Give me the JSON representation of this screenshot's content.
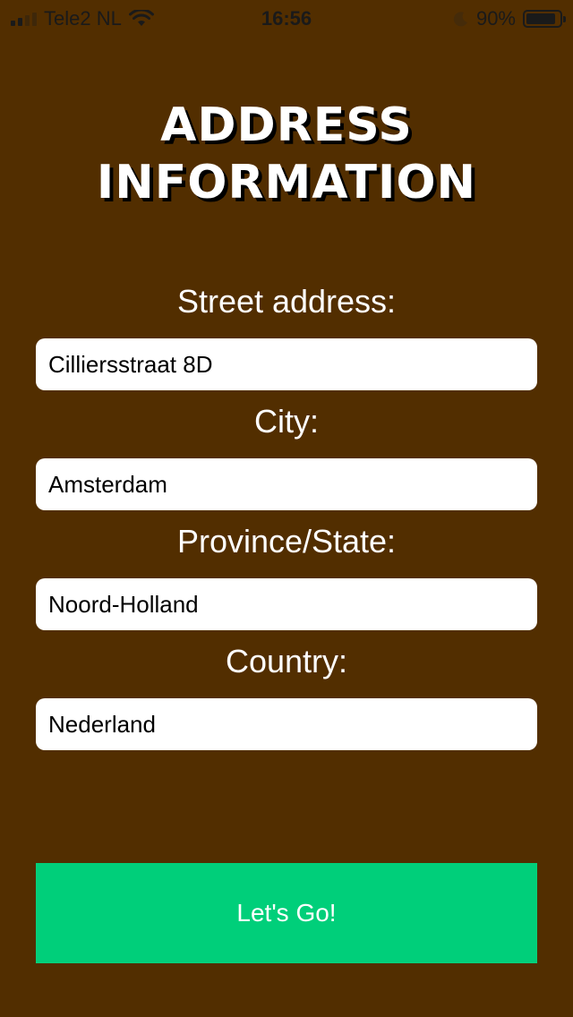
{
  "status_bar": {
    "carrier": "Tele2 NL",
    "time": "16:56",
    "battery_percent": "90%",
    "battery_level": 0.9,
    "icons": [
      "signal-icon",
      "wifi-icon",
      "moon-icon",
      "battery-icon"
    ]
  },
  "title": "ADDRESS\nINFORMATION",
  "form": {
    "street": {
      "label": "Street address:",
      "value": "Cilliersstraat 8D"
    },
    "city": {
      "label": "City:",
      "value": "Amsterdam"
    },
    "province": {
      "label": "Province/State:",
      "value": "Noord-Holland"
    },
    "country": {
      "label": "Country:",
      "value": "Nederland"
    }
  },
  "button": {
    "label": "Let's Go!"
  },
  "colors": {
    "background": "#522e00",
    "button": "#00cf7a",
    "input_background": "#ffffff",
    "text": "#ffffff"
  }
}
